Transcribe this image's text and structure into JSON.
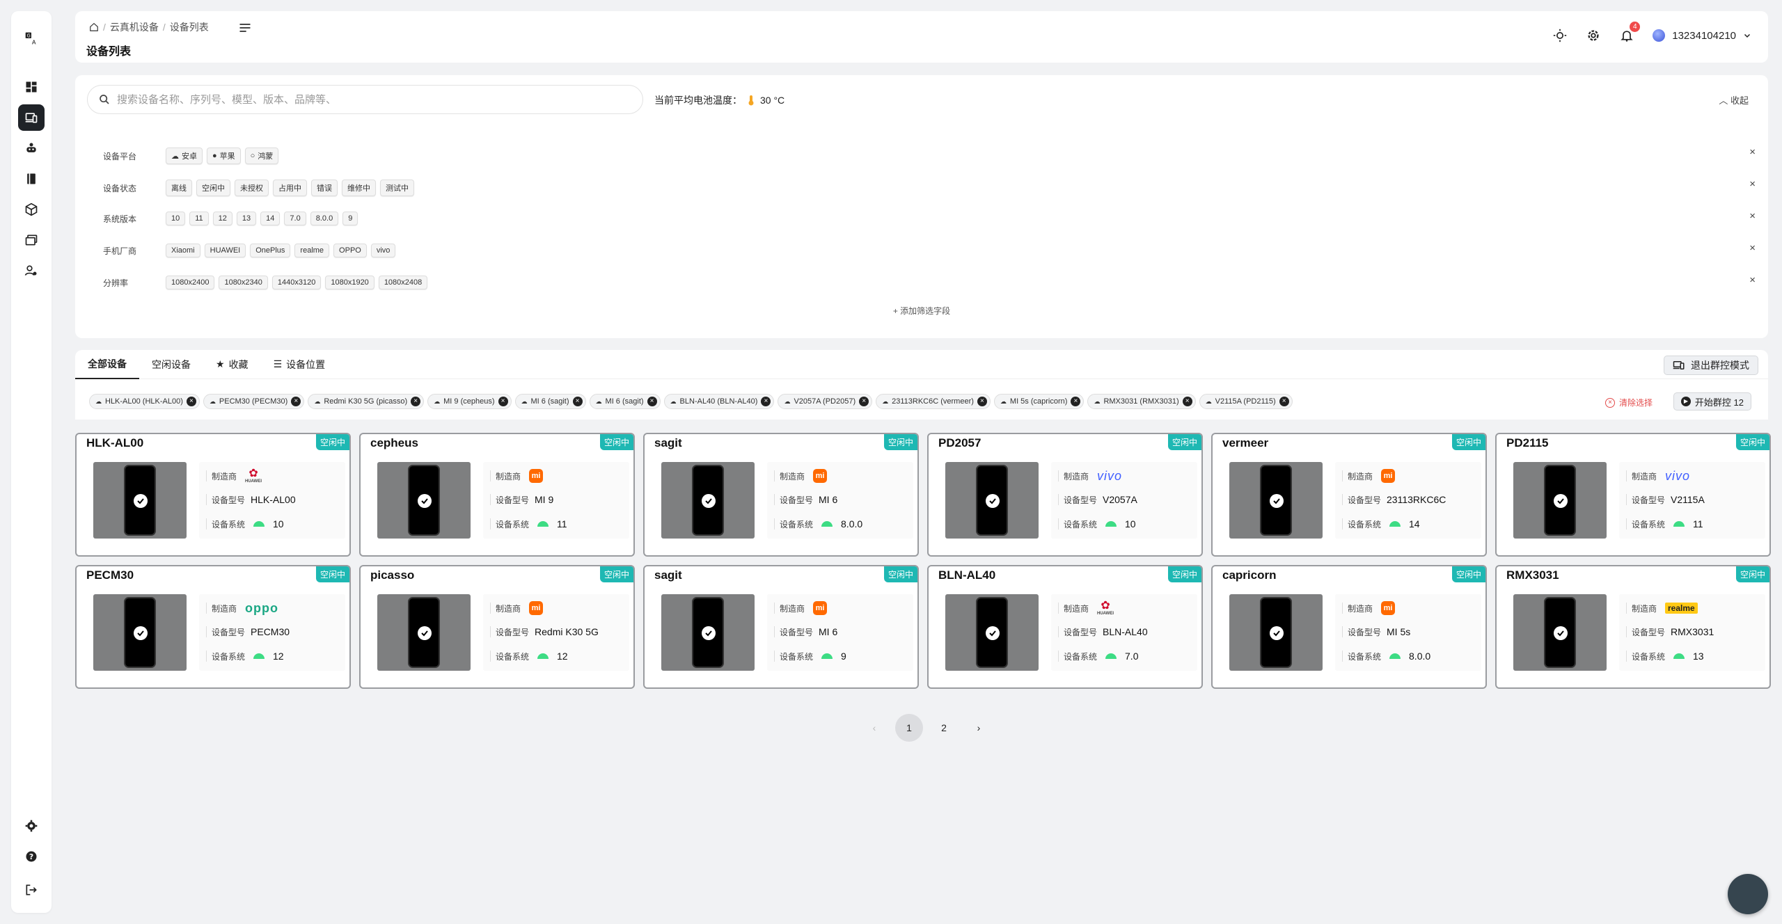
{
  "sidebar": {
    "items": [
      {
        "icon": "translate-logo-icon"
      },
      {
        "icon": "dashboard-icon"
      },
      {
        "icon": "devices-icon",
        "active": true
      },
      {
        "icon": "robot-icon"
      },
      {
        "icon": "book-icon"
      },
      {
        "icon": "cube-icon"
      },
      {
        "icon": "folders-icon"
      },
      {
        "icon": "user-settings-icon"
      }
    ],
    "bottom": [
      {
        "icon": "settings-icon"
      },
      {
        "icon": "help-icon"
      },
      {
        "icon": "logout-icon"
      }
    ]
  },
  "header": {
    "breadcrumb": [
      "云真机设备",
      "设备列表"
    ],
    "title": "设备列表",
    "notifications": "4",
    "user": "13234104210"
  },
  "filter": {
    "search_placeholder": "搜索设备名称、序列号、模型、版本、品牌等、",
    "temp_label": "当前平均电池温度：",
    "temp_value": "30 °C",
    "collapse": "收起",
    "rows": [
      {
        "label": "设备平台",
        "chips": [
          "安卓",
          "苹果",
          "鸿蒙"
        ]
      },
      {
        "label": "设备状态",
        "chips": [
          "离线",
          "空闲中",
          "未授权",
          "占用中",
          "错误",
          "维修中",
          "测试中"
        ]
      },
      {
        "label": "系统版本",
        "chips": [
          "10",
          "11",
          "12",
          "13",
          "14",
          "7.0",
          "8.0.0",
          "9"
        ]
      },
      {
        "label": "手机厂商",
        "chips": [
          "Xiaomi",
          "HUAWEI",
          "OnePlus",
          "realme",
          "OPPO",
          "vivo"
        ]
      },
      {
        "label": "分辨率",
        "chips": [
          "1080x2400",
          "1080x2340",
          "1440x3120",
          "1080x1920",
          "1080x2408"
        ]
      }
    ],
    "add_field": "添加筛选字段"
  },
  "tabs": [
    "全部设备",
    "空闲设备",
    "收藏",
    "设备位置"
  ],
  "exit_group": "退出群控模式",
  "selected": [
    "HLK-AL00 (HLK-AL00)",
    "PECM30 (PECM30)",
    "Redmi K30 5G (picasso)",
    "MI 9 (cepheus)",
    "MI 6 (sagit)",
    "MI 6 (sagit)",
    "BLN-AL40 (BLN-AL40)",
    "V2057A (PD2057)",
    "23113RKC6C (vermeer)",
    "MI 5s (capricorn)",
    "RMX3031 (RMX3031)",
    "V2115A (PD2115)"
  ],
  "clear_selection": "清除选择",
  "start_group": "开始群控 12",
  "labels": {
    "maker": "制造商",
    "model": "设备型号",
    "os": "设备系统"
  },
  "devices": [
    {
      "name": "HLK-AL00",
      "status": "空闲中",
      "brand": "huawei",
      "model": "HLK-AL00",
      "os": "10"
    },
    {
      "name": "cepheus",
      "status": "空闲中",
      "brand": "mi",
      "model": "MI 9",
      "os": "11"
    },
    {
      "name": "sagit",
      "status": "空闲中",
      "brand": "mi",
      "model": "MI 6",
      "os": "8.0.0"
    },
    {
      "name": "PD2057",
      "status": "空闲中",
      "brand": "vivo",
      "model": "V2057A",
      "os": "10"
    },
    {
      "name": "vermeer",
      "status": "空闲中",
      "brand": "mi",
      "model": "23113RKC6C",
      "os": "14"
    },
    {
      "name": "PD2115",
      "status": "空闲中",
      "brand": "vivo",
      "model": "V2115A",
      "os": "11"
    },
    {
      "name": "PECM30",
      "status": "空闲中",
      "brand": "oppo",
      "model": "PECM30",
      "os": "12"
    },
    {
      "name": "picasso",
      "status": "空闲中",
      "brand": "mi",
      "model": "Redmi K30 5G",
      "os": "12"
    },
    {
      "name": "sagit",
      "status": "空闲中",
      "brand": "mi",
      "model": "MI 6",
      "os": "9"
    },
    {
      "name": "BLN-AL40",
      "status": "空闲中",
      "brand": "huawei",
      "model": "BLN-AL40",
      "os": "7.0"
    },
    {
      "name": "capricorn",
      "status": "空闲中",
      "brand": "mi",
      "model": "MI 5s",
      "os": "8.0.0"
    },
    {
      "name": "RMX3031",
      "status": "空闲中",
      "brand": "realme",
      "model": "RMX3031",
      "os": "13"
    }
  ],
  "brand_logos": {
    "huawei": "HUAWEI",
    "mi": "mi",
    "vivo": "vivo",
    "oppo": "oppo",
    "realme": "realme"
  },
  "pagination": {
    "pages": [
      "1",
      "2"
    ],
    "current": "1"
  },
  "colors": {
    "status": "#1eb8b3",
    "mi": "#ff6900",
    "vivo": "#415fff",
    "oppo": "#1ba784",
    "huawei": "#cf0a2c",
    "realme": "#ffc915"
  }
}
